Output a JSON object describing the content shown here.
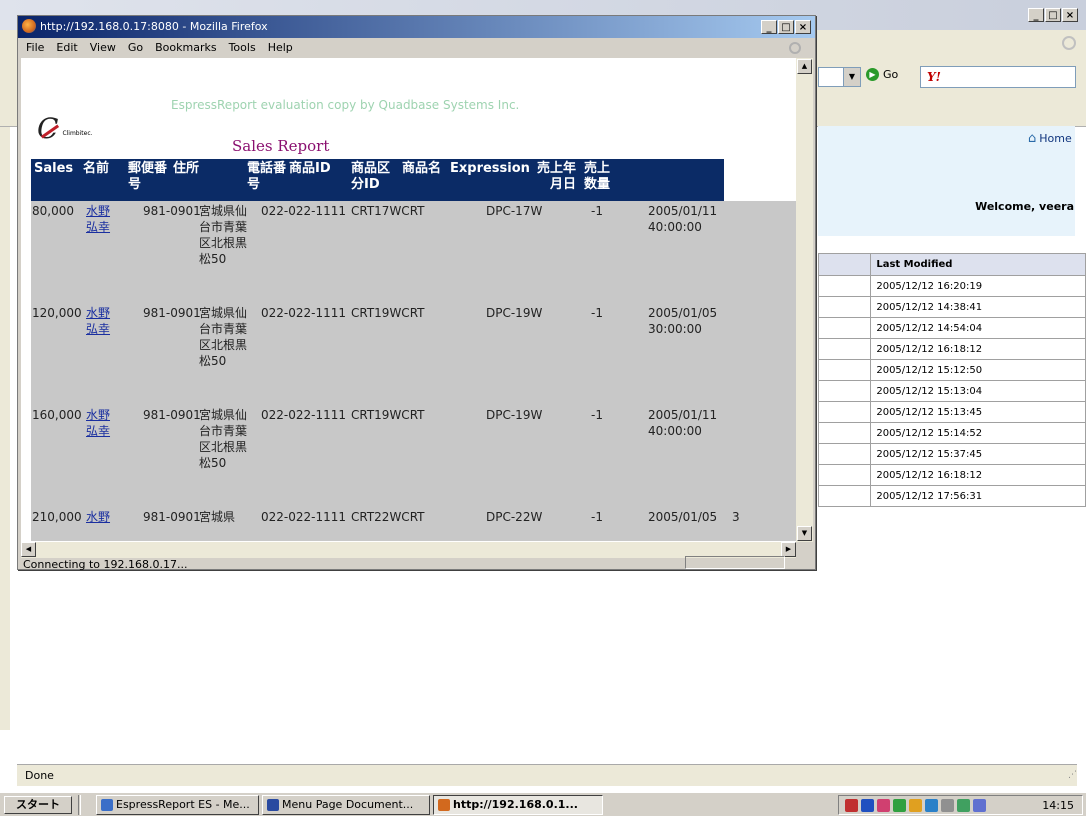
{
  "background": {
    "go_label": "Go",
    "yahoo_badge": "Y!",
    "home_link": "Home",
    "welcome": "Welcome, veera",
    "table_header": "Last Modified",
    "last_modified": [
      "2005/12/12 16:20:19",
      "2005/12/12 14:38:41",
      "2005/12/12 14:54:04",
      "2005/12/12 16:18:12",
      "2005/12/12 15:12:50",
      "2005/12/12 15:13:04",
      "2005/12/12 15:13:45",
      "2005/12/12 15:14:52",
      "2005/12/12 15:37:45",
      "2005/12/12 16:18:12",
      "2005/12/12 17:56:31"
    ],
    "status": "Done"
  },
  "popup": {
    "title": "http://192.168.0.17:8080 - Mozilla Firefox",
    "menu": [
      "File",
      "Edit",
      "View",
      "Go",
      "Bookmarks",
      "Tools",
      "Help"
    ],
    "status": "Connecting to 192.168.0.17..."
  },
  "report": {
    "watermark": "EspressReport evaluation copy by Quadbase Systems Inc.",
    "logo_text": "Climbitec.",
    "title": "Sales Report",
    "headers": [
      "Sales",
      "名前",
      "郵便番号",
      "住所",
      "電話番号",
      "商品ID",
      "商品区分ID",
      "商品名",
      "Expression",
      "売上年月日",
      "売上数量"
    ],
    "rows": [
      {
        "sales": "80,000",
        "name": "水野 弘幸",
        "zip": "981-0901",
        "addr": "宮城県仙台市青葉区北根黒松50",
        "tel": "022-022-1111",
        "pid": "CRT17WCRT",
        "pname": "DPC-17W",
        "expr": "-1",
        "date": "2005/01/11",
        "qty": "40:00:00"
      },
      {
        "sales": "120,000",
        "name": "水野 弘幸",
        "zip": "981-0901",
        "addr": "宮城県仙台市青葉区北根黒松50",
        "tel": "022-022-1111",
        "pid": "CRT19WCRT",
        "pname": "DPC-19W",
        "expr": "-1",
        "date": "2005/01/05",
        "qty": "30:00:00"
      },
      {
        "sales": "160,000",
        "name": "水野 弘幸",
        "zip": "981-0901",
        "addr": "宮城県仙台市青葉区北根黒松50",
        "tel": "022-022-1111",
        "pid": "CRT19WCRT",
        "pname": "DPC-19W",
        "expr": "-1",
        "date": "2005/01/11",
        "qty": "40:00:00"
      },
      {
        "sales": "210,000",
        "name": "水野",
        "zip": "981-0901",
        "addr": "宮城県",
        "tel": "022-022-1111",
        "pid": "CRT22WCRT",
        "pname": "DPC-22W",
        "expr": "-1",
        "date": "2005/01/05",
        "qty": "3"
      }
    ]
  },
  "taskbar": {
    "start": "スタート",
    "items": [
      "EspressReport ES - Me...",
      "Menu Page Document...",
      "http://192.168.0.1..."
    ],
    "clock": "14:15"
  }
}
